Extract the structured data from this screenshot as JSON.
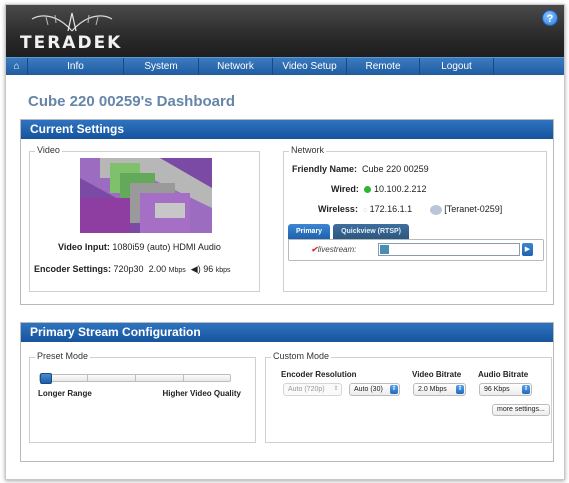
{
  "brand": {
    "logo_text": "TERADEK",
    "help_label": "?"
  },
  "nav": {
    "items": [
      "Info",
      "System",
      "Network",
      "Video Setup",
      "Remote",
      "Logout"
    ]
  },
  "page_title": "Cube 220 00259's Dashboard",
  "current_settings": {
    "title": "Current Settings",
    "video": {
      "label": "Video",
      "input_label": "Video Input:",
      "input_value": "1080i59 (auto)",
      "audio_value": "HDMI Audio",
      "encoder_label": "Encoder Settings:",
      "encoder_res": "720p30",
      "bitrate_value": "2.00",
      "bitrate_unit": "Mbps",
      "audio_bitrate_value": "96",
      "audio_bitrate_unit": "kbps"
    },
    "network": {
      "label": "Network",
      "friendly_name_label": "Friendly Name:",
      "friendly_name": "Cube 220 00259",
      "wired_label": "Wired:",
      "wired_ip": "10.100.2.212",
      "wireless_label": "Wireless:",
      "wireless_ip": "172.16.1.1",
      "ssid": "[Teranet-0259]",
      "tabs": [
        "Primary",
        "Quickview (RTSP)"
      ],
      "stream_brand": "livestream",
      "stream_suffix": ":",
      "stream_go": "▶"
    }
  },
  "stream_config": {
    "title": "Primary Stream Configuration",
    "preset": {
      "label": "Preset Mode",
      "left_label": "Longer Range",
      "right_label": "Higher Video Quality",
      "position": 0
    },
    "custom": {
      "label": "Custom Mode",
      "encoder_resolution_label": "Encoder Resolution",
      "resolution_value": "Auto (720p)",
      "framerate_value": "Auto (30)",
      "video_bitrate_label": "Video Bitrate",
      "video_bitrate_value": "2.0 Mbps",
      "audio_bitrate_label": "Audio Bitrate",
      "audio_bitrate_value": "96 Kbps",
      "more_settings": "more settings..."
    }
  },
  "colors": {
    "nav_blue": "#1f5c9f",
    "panel_head": "#16549d",
    "title": "#6685a8",
    "wired_dot": "#2fb52f"
  }
}
